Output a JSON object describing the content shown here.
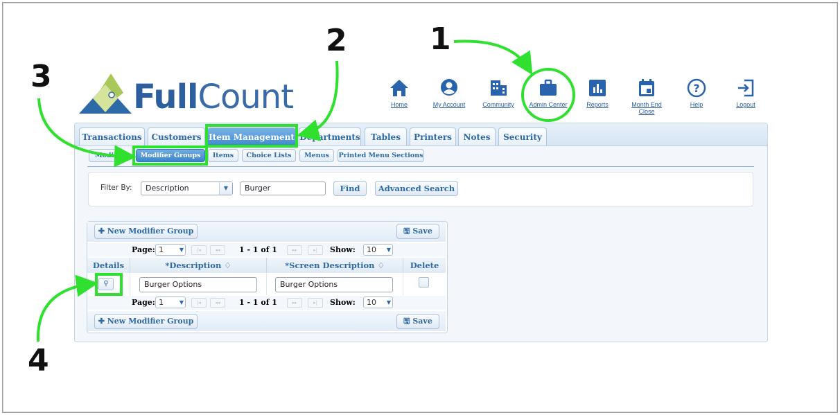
{
  "logo": {
    "text_full": "Full",
    "text_count": "Count"
  },
  "top_nav": [
    {
      "label": "Home",
      "icon": "home-icon"
    },
    {
      "label": "My Account",
      "icon": "user-icon"
    },
    {
      "label": "Community",
      "icon": "building-icon"
    },
    {
      "label": "Admin Center",
      "icon": "briefcase-icon"
    },
    {
      "label": "Reports",
      "icon": "bar-chart-icon"
    },
    {
      "label": "Month End Close",
      "label_line1": "Month End",
      "label_line2": "Close",
      "icon": "calendar-icon"
    },
    {
      "label": "Help",
      "icon": "help-icon"
    },
    {
      "label": "Logout",
      "icon": "logout-icon"
    }
  ],
  "main_tabs": [
    "Transactions",
    "Customers",
    "Item Management",
    "Departments",
    "Tables",
    "Printers",
    "Notes",
    "Security"
  ],
  "active_main_tab": "Item Management",
  "sub_tabs": [
    "Modi",
    "Modifier Groups",
    "Items",
    "Choice Lists",
    "Menus",
    "Printed Menu Sections"
  ],
  "active_sub_tab": "Modifier Groups",
  "filter": {
    "label": "Filter By:",
    "select_value": "Description",
    "search_value": "Burger",
    "find_label": "Find",
    "advanced_label": "Advanced Search"
  },
  "grid": {
    "new_button": "New Modifier Group",
    "save_button": "Save",
    "pager": {
      "page_label": "Page:",
      "page_value": "1",
      "range_text": "1 - 1 of 1",
      "show_label": "Show:",
      "show_value": "10"
    },
    "columns": [
      "Details",
      "*Description ♢",
      "*Screen Description ♢",
      "Delete"
    ],
    "rows": [
      {
        "description": "Burger Options",
        "screen_description": "Burger Options",
        "delete": false
      }
    ]
  },
  "annotations": {
    "step1": "1",
    "step2": "2",
    "step3": "3",
    "step4": "4"
  },
  "colors": {
    "highlight": "#2fe02f",
    "brand_blue": "#2d5f9e",
    "tab_active": "#3f8ad0"
  }
}
